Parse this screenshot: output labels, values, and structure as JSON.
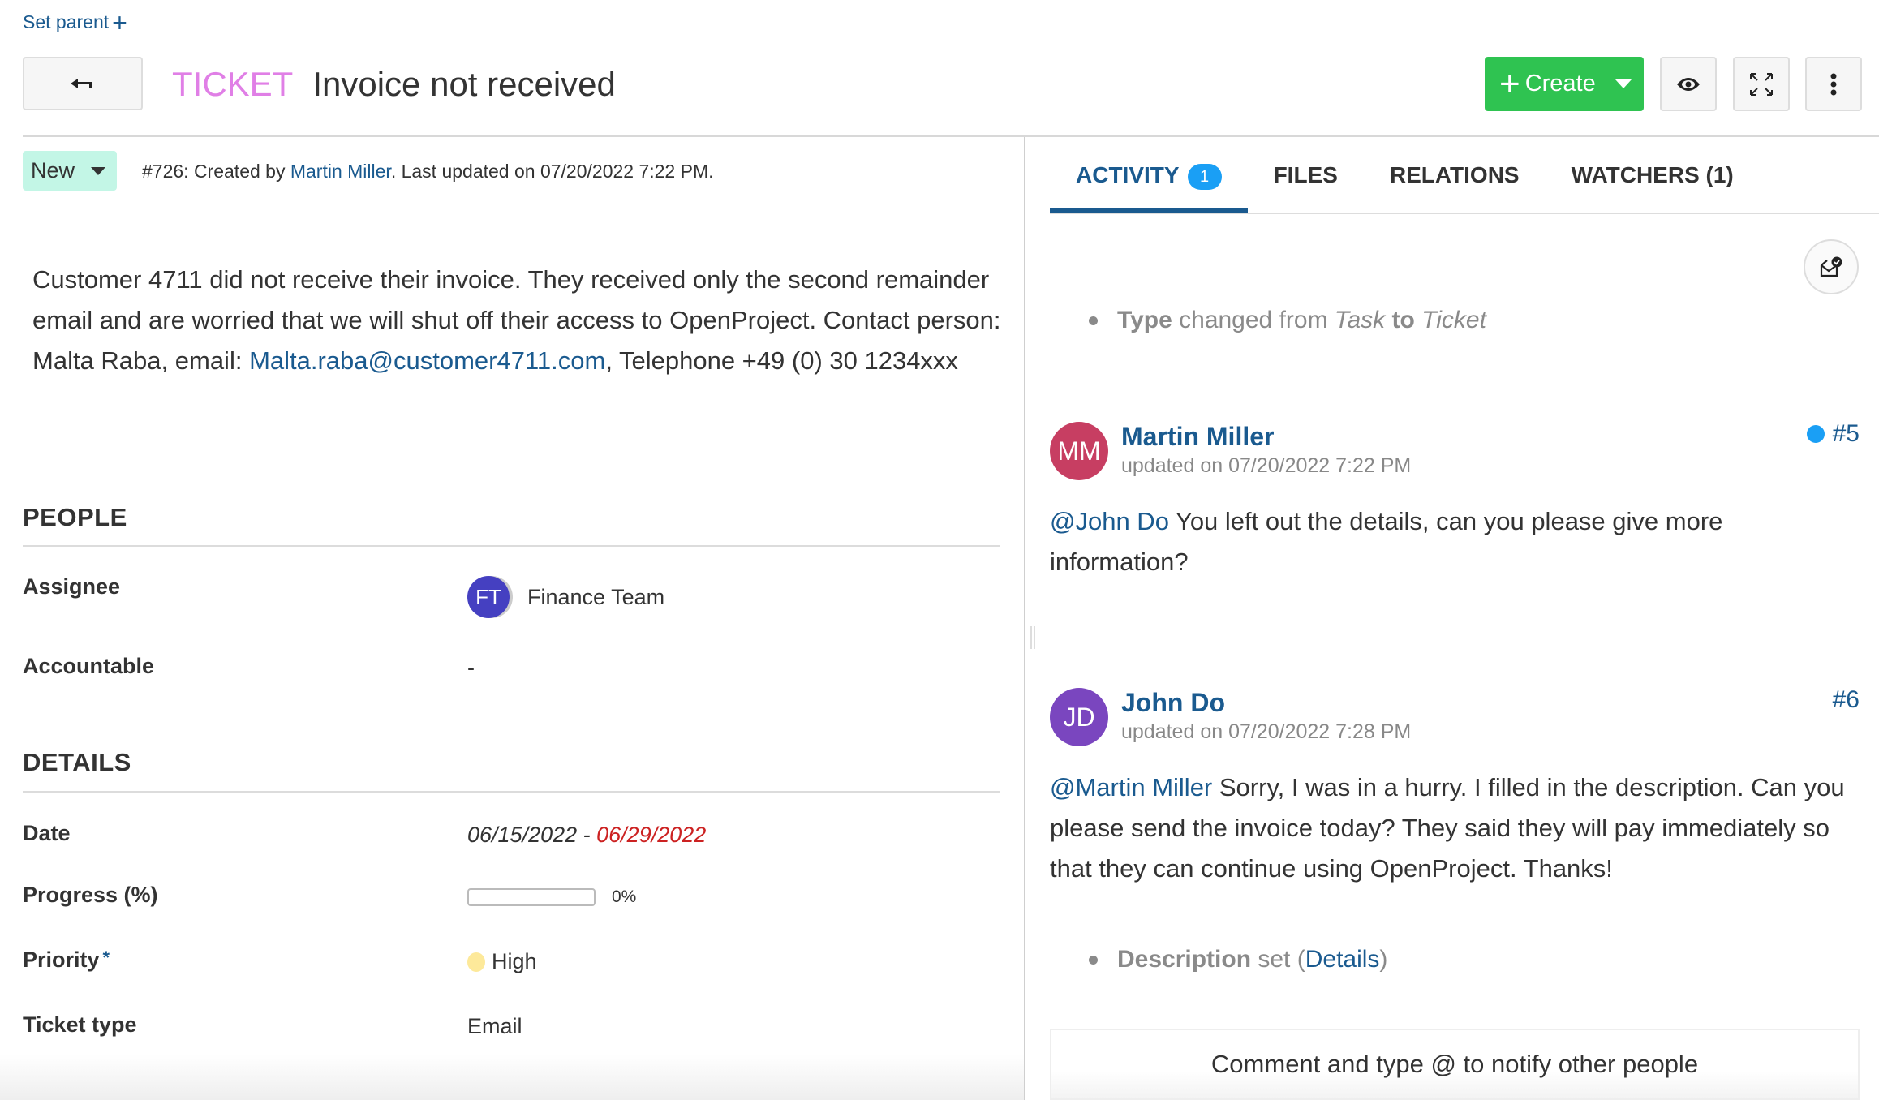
{
  "header": {
    "set_parent_label": "Set parent",
    "type_label": "TICKET",
    "subject": "Invoice not received",
    "create_label": "Create",
    "type_color": "#e07fe6"
  },
  "status": {
    "label": "New",
    "color": "#c3f6e6"
  },
  "meta": {
    "prefix": "#726: Created by ",
    "author": "Martin Miller",
    "suffix": ". Last updated on 07/20/2022 7:22 PM."
  },
  "description": {
    "text1": "Customer 4711 did not receive their invoice. They received only the second remainder email and are worried that we will shut off their access to OpenProject. Contact person: Malta Raba, email: ",
    "email": "Malta.raba@customer4711.com",
    "text2": ", Telephone +49 (0) 30 1234xxx"
  },
  "people": {
    "title": "PEOPLE",
    "assignee_label": "Assignee",
    "assignee_initials": "FT",
    "assignee_name": "Finance Team",
    "accountable_label": "Accountable",
    "accountable_value": "-"
  },
  "details": {
    "title": "DETAILS",
    "date_label": "Date",
    "date_start": "06/15/2022",
    "date_sep": " - ",
    "date_end": "06/29/2022",
    "progress_label": "Progress (%)",
    "progress_value": 0,
    "progress_text": "0%",
    "priority_label": "Priority",
    "priority_required": "*",
    "priority_value": "High",
    "priority_color": "#fde99a",
    "ticket_type_label": "Ticket type",
    "ticket_type_value": "Email"
  },
  "tabs": [
    {
      "label": "ACTIVITY",
      "badge": "1",
      "active": true
    },
    {
      "label": "FILES"
    },
    {
      "label": "RELATIONS"
    },
    {
      "label": "WATCHERS (1)"
    }
  ],
  "activity": {
    "type_change": {
      "field": "Type",
      "mid": " changed from ",
      "from": "Task",
      "to_word": " to ",
      "to": "Ticket"
    },
    "comments": [
      {
        "initials": "MM",
        "author": "Martin Miller",
        "updated": "updated on 07/20/2022 7:22 PM",
        "number": "#5",
        "unread": true,
        "mention": "@John Do",
        "text": " You left out the details, can you please give more information?",
        "avatar_color": "#c73e62"
      },
      {
        "initials": "JD",
        "author": "John Do",
        "updated": "updated on 07/20/2022 7:28 PM",
        "number": "#6",
        "unread": false,
        "mention": "@Martin Miller",
        "text": " Sorry, I was in a hurry. I filled in the description. Can you please send the invoice today? They said they will pay immediately so that they can continue using OpenProject. Thanks!",
        "avatar_color": "#7a46bf"
      }
    ],
    "description_change": {
      "field": "Description",
      "mid": " set (",
      "link": "Details",
      "end": ")"
    },
    "comment_placeholder": "Comment and type @ to notify other people"
  }
}
